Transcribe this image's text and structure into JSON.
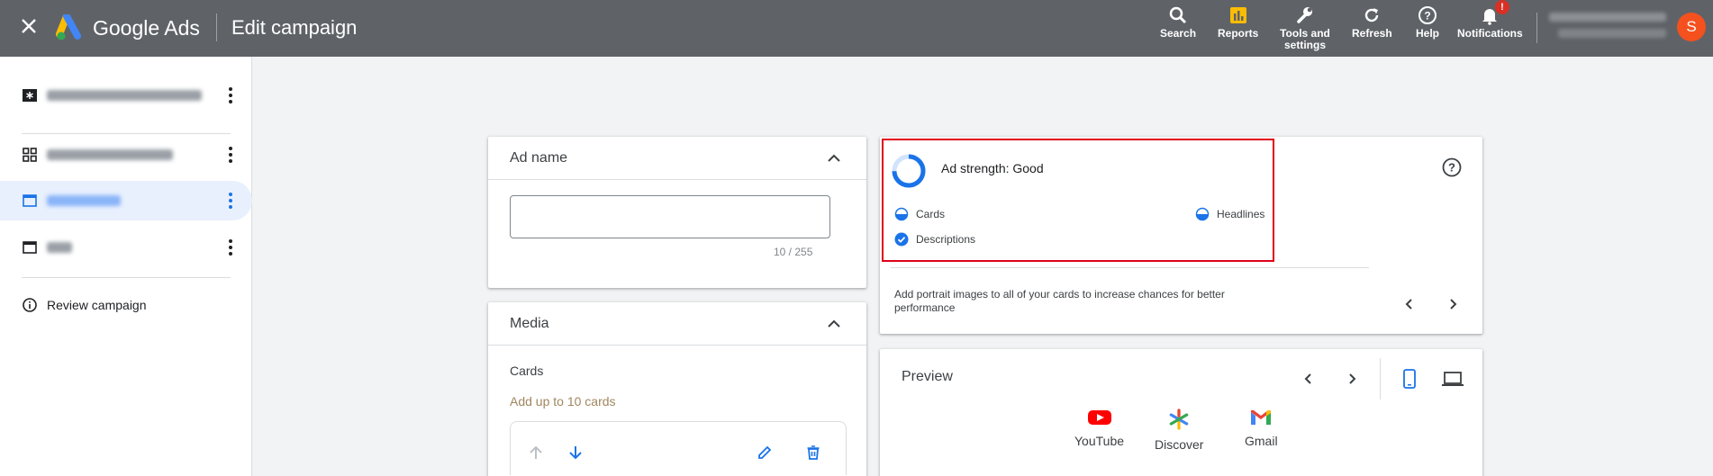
{
  "header": {
    "brand": "Google Ads",
    "title": "Edit campaign",
    "tools": [
      {
        "label": "Search",
        "icon": "search-icon"
      },
      {
        "label": "Reports",
        "icon": "reports-icon"
      },
      {
        "label": "Tools and settings",
        "icon": "wrench-icon"
      },
      {
        "label": "Refresh",
        "icon": "refresh-icon"
      },
      {
        "label": "Help",
        "icon": "help-icon"
      },
      {
        "label": "Notifications",
        "icon": "bell-icon",
        "badge": "!"
      }
    ],
    "avatar_initial": "S"
  },
  "sidebar": {
    "review_label": "Review campaign"
  },
  "ad_name": {
    "heading": "Ad name",
    "value": "",
    "counter": "10 / 255"
  },
  "media": {
    "heading": "Media",
    "subheading": "Cards",
    "hint": "Add up to 10 cards"
  },
  "ad_strength": {
    "title": "Ad strength: Good",
    "criteria": {
      "cards": "Cards",
      "headlines": "Headlines",
      "descriptions": "Descriptions"
    },
    "tip": "Add portrait images to all of your cards to increase chances for better performance"
  },
  "preview": {
    "heading": "Preview",
    "platforms": [
      "YouTube",
      "Discover",
      "Gmail"
    ]
  },
  "colors": {
    "topbar": "#5f6368",
    "accent": "#1a73e8",
    "highlight_border": "#e0001a",
    "avatar": "#f4511e"
  }
}
